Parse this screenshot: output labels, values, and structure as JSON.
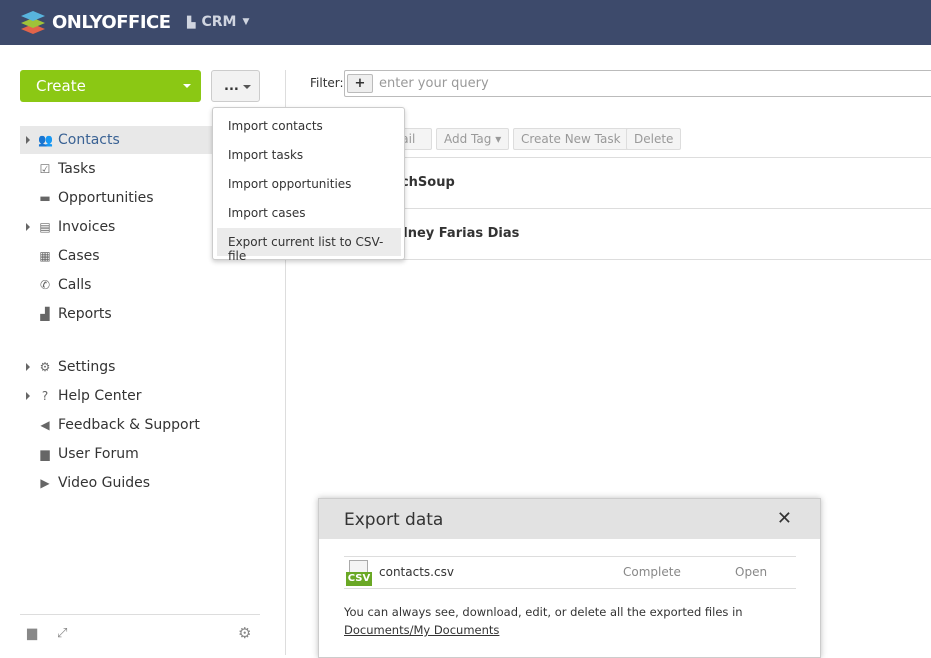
{
  "header": {
    "logo": "ONLYOFFICE",
    "module": "CRM"
  },
  "sidebar": {
    "create_label": "Create",
    "more_label": "...",
    "items": [
      {
        "label": "Contacts",
        "icon": "contacts-icon",
        "expandable": true,
        "selected": true
      },
      {
        "label": "Tasks",
        "icon": "tasks-icon"
      },
      {
        "label": "Opportunities",
        "icon": "briefcase-icon"
      },
      {
        "label": "Invoices",
        "icon": "invoice-icon",
        "expandable": true
      },
      {
        "label": "Cases",
        "icon": "calendar-icon"
      },
      {
        "label": "Calls",
        "icon": "phone-icon"
      },
      {
        "label": "Reports",
        "icon": "bar-chart-icon"
      }
    ],
    "secondary": [
      {
        "label": "Settings",
        "icon": "gear-icon",
        "expandable": true
      },
      {
        "label": "Help Center",
        "icon": "question-icon",
        "expandable": true
      },
      {
        "label": "Feedback & Support",
        "icon": "megaphone-icon"
      },
      {
        "label": "User Forum",
        "icon": "chat-icon"
      },
      {
        "label": "Video Guides",
        "icon": "video-icon"
      }
    ]
  },
  "filter": {
    "label": "Filter:",
    "placeholder": "enter your query"
  },
  "toolbar": {
    "send_email": "Send Email",
    "add_tag": "Add Tag",
    "create_task": "Create New Task",
    "delete": "Delete"
  },
  "contacts": [
    {
      "name": "TechSoup"
    },
    {
      "name": "Volney Farias Dias"
    }
  ],
  "dropdown": {
    "items": [
      "Import contacts",
      "Import tasks",
      "Import opportunities",
      "Import cases",
      "Export current list to CSV-file"
    ]
  },
  "dialog": {
    "title": "Export data",
    "file": "contacts.csv",
    "status": "Complete",
    "action": "Open",
    "file_badge": "CSV",
    "note": "You can always see, download, edit, or delete all the exported files in",
    "link": "Documents/My Documents"
  }
}
